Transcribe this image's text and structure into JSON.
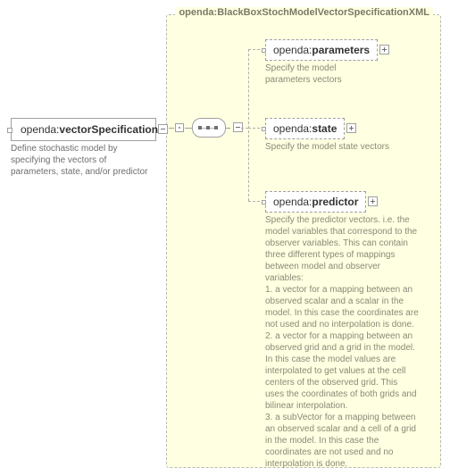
{
  "root": {
    "namespace": "openda:",
    "name": "vectorSpecification",
    "description": "Define stochastic model by specifying the vectors of parameters, state, and/or predictor"
  },
  "type": {
    "title": "openda:BlackBoxStochModelVectorSpecificationXML"
  },
  "children": {
    "parameters": {
      "namespace": "openda:",
      "name": "parameters",
      "description": "Specify the model parameters vectors"
    },
    "state": {
      "namespace": "openda:",
      "name": "state",
      "description": "Specify the model state vectors"
    },
    "predictor": {
      "namespace": "openda:",
      "name": "predictor",
      "description": "Specify the predictor vectors. i.e. the model variables that correspond to the observer variables. This can contain three different types of mappings between model and observer variables:\n1. a vector for a mapping between an observed scalar and a scalar in the model. In this case the coordinates are not used and no interpolation is done.\n2. a vector for a mapping between an observed grid and a grid in the model. In this case the model values are interpolated to get values at the cell centers of the observed grid. This uses the coordinates of both grids and bilinear interpolation.\n3. a subVector for a mapping between an observed scalar and a cell of a grid in the model. In this case the coordinates are not used and no interpolation is done."
    }
  }
}
